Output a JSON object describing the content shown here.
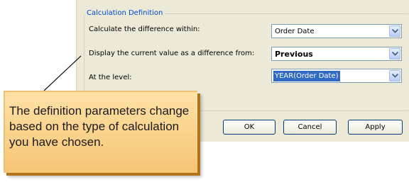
{
  "group": {
    "title": "Calculation Definition"
  },
  "rows": [
    {
      "label": "Calculate the difference within:",
      "value": "Order Date"
    },
    {
      "label": "Display the current value as a difference from:",
      "value": "Previous"
    },
    {
      "label": "At the level:",
      "value": "YEAR(Order Date)"
    }
  ],
  "buttons": {
    "ok": "OK",
    "cancel": "Cancel",
    "apply": "Apply"
  },
  "callout": {
    "text": "The definition parameters change based on the type of calculation you have chosen."
  },
  "colors": {
    "dialog_bg": "#ece9d8",
    "legend_text": "#0046d5",
    "selection": "#316ac5",
    "note_bg": "#f6c575"
  },
  "icons": {
    "combo_arrow": "chevron-down-icon"
  }
}
